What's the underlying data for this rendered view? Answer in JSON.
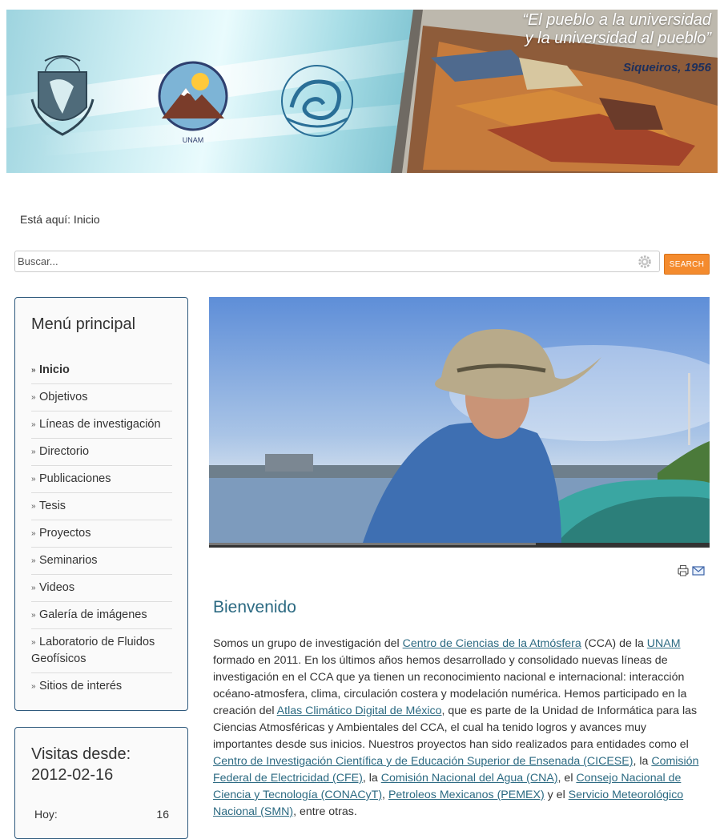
{
  "banner": {
    "quote_line1": "“El pueblo a la universidad",
    "quote_line2": "y la universidad al pueblo”",
    "quote_author": "Siqueiros, 1956",
    "logos": [
      "unam-shield-logo",
      "cca-logo",
      "interaccion-oceano-atmosfera-logo"
    ]
  },
  "breadcrumb": {
    "text": "Está aquí: Inicio"
  },
  "search": {
    "placeholder": "Buscar...",
    "value": "",
    "button_label": "Search",
    "icon": "gear-icon"
  },
  "sidebar": {
    "menu_title": "Menú principal",
    "items": [
      {
        "label": "Inicio",
        "active": true
      },
      {
        "label": "Objetivos"
      },
      {
        "label": "Líneas de investigación"
      },
      {
        "label": "Directorio"
      },
      {
        "label": "Publicaciones"
      },
      {
        "label": "Tesis"
      },
      {
        "label": "Proyectos"
      },
      {
        "label": "Seminarios"
      },
      {
        "label": "Videos"
      },
      {
        "label": "Galería de imágenes"
      },
      {
        "label": "Laboratorio de Fluidos Geofísicos"
      },
      {
        "label": "Sitios de interés"
      }
    ],
    "visits_title": "Visitas desde: 2012-02-16",
    "visits_rows": [
      {
        "label": "Hoy:",
        "value": "16"
      }
    ]
  },
  "main": {
    "tools": [
      "print-icon",
      "email-icon"
    ],
    "title": "Bienvenido",
    "article": {
      "t1": "Somos un grupo de investigación del ",
      "l1": "Centro de Ciencias de la Atmósfera",
      "t2": " (CCA) de la ",
      "l2": "UNAM",
      "t3": " formado en 2011.  En los últimos años hemos desarrollado y consolidado nuevas líneas de investigación en el CCA que ya tienen un reconocimiento nacional e internacional: interacción océano-atmosfera, clima, circulación costera y modelación numérica. Hemos participado en la creación del ",
      "l3": "Atlas Climático Digital de México",
      "t4": ", que es parte de la Unidad de Informática para las Ciencias Atmosféricas y Ambientales del CCA, el cual ha tenido logros y avances muy importantes desde sus inicios. Nuestros proyectos han sido realizados para entidades como el ",
      "l4": "Centro de Investigación Científica y de Educación Superior de Ensenada (CICESE)",
      "t5": ", la ",
      "l5": "Comisión Federal de Electricidad (CFE)",
      "t6": ", la ",
      "l6": "Comisión Nacional del Agua (CNA)",
      "t7": ", el ",
      "l7": "Consejo Nacional de Ciencia y Tecnología (CONACyT)",
      "t8": ", ",
      "l8": "Petroleos Mexicanos (PEMEX)",
      "t9": " y el ",
      "l9": "Servicio Meteorológico Nacional (SMN)",
      "t10": ", entre otras."
    }
  },
  "colors": {
    "accent": "#2c6a82",
    "button": "#f48b2e",
    "module_border": "#2f5a7d"
  }
}
